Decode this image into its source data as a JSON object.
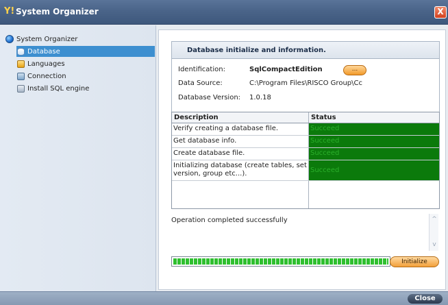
{
  "window": {
    "title": "System Organizer",
    "app_icon_glyph": "Y!",
    "close_glyph": "X"
  },
  "sidebar": {
    "root_label": "System Organizer",
    "items": [
      {
        "label": "Database",
        "icon": "database-icon",
        "selected": true
      },
      {
        "label": "Languages",
        "icon": "languages-icon",
        "selected": false
      },
      {
        "label": "Connection",
        "icon": "connection-icon",
        "selected": false
      },
      {
        "label": "Install SQL engine",
        "icon": "install-sql-icon",
        "selected": false
      }
    ]
  },
  "info": {
    "header": "Database initialize and information.",
    "identification_label": "Identification:",
    "identification_value": "SqlCompactEdition",
    "browse_button": "...",
    "data_source_label": "Data Source:",
    "data_source_value": "C:\\Program Files\\RISCO Group\\Cc",
    "version_label": "Database Version:",
    "version_value": "1.0.18"
  },
  "status_table": {
    "columns": [
      "Description",
      "Status"
    ],
    "rows": [
      {
        "description": "Verify creating a database file.",
        "status": "Succeed"
      },
      {
        "description": "Get database info.",
        "status": "Succeed"
      },
      {
        "description": "Create database file.",
        "status": "Succeed"
      },
      {
        "description": "Initializing database (create tables, set version, group etc...).",
        "status": "Succeed"
      }
    ]
  },
  "operation_message": "Operation completed successfully",
  "scroll_up": "^",
  "scroll_down": "v",
  "progress": {
    "value": 1.0
  },
  "initialize_button": "Initialize",
  "close_button": "Close",
  "colors": {
    "status_bg": "#0b7a0b",
    "status_text": "#2bb02b",
    "selected_nav": "#3d8fd0",
    "accent_button": "#f2a03a"
  }
}
